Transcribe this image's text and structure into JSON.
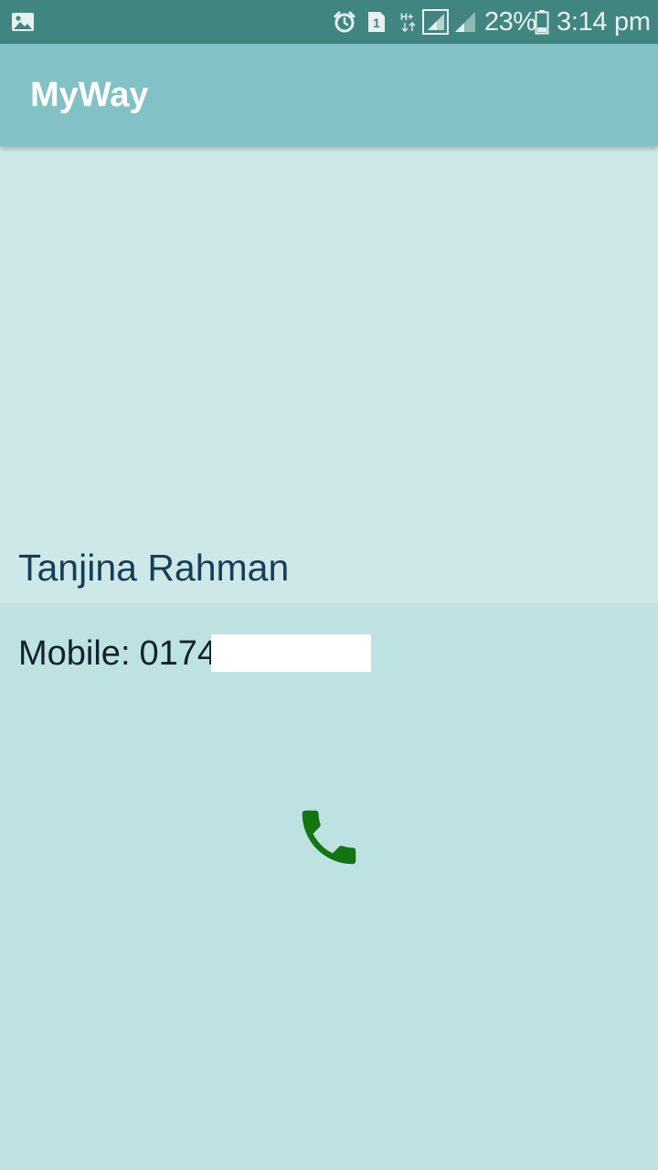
{
  "status_bar": {
    "battery_percent": "23%",
    "time": "3:14 pm",
    "sim_slot": "1",
    "network_type": "H+",
    "icons": [
      "gallery-icon",
      "alarm-icon",
      "sim-icon",
      "network-type-icon",
      "signal-icon",
      "signal-weak-icon",
      "battery-icon"
    ]
  },
  "app_bar": {
    "title": "MyWay"
  },
  "contact": {
    "name": "Tanjina Rahman",
    "mobile_label": "Mobile:",
    "mobile_visible": "0174"
  },
  "actions": {
    "call_icon": "phone-icon",
    "call_color": "#127512"
  },
  "colors": {
    "status_bar": "#418581",
    "app_bar": "#82c2c6",
    "header_band": "#cee8e8",
    "detail_background": "#bee2e2",
    "name_text": "#163e5a"
  }
}
